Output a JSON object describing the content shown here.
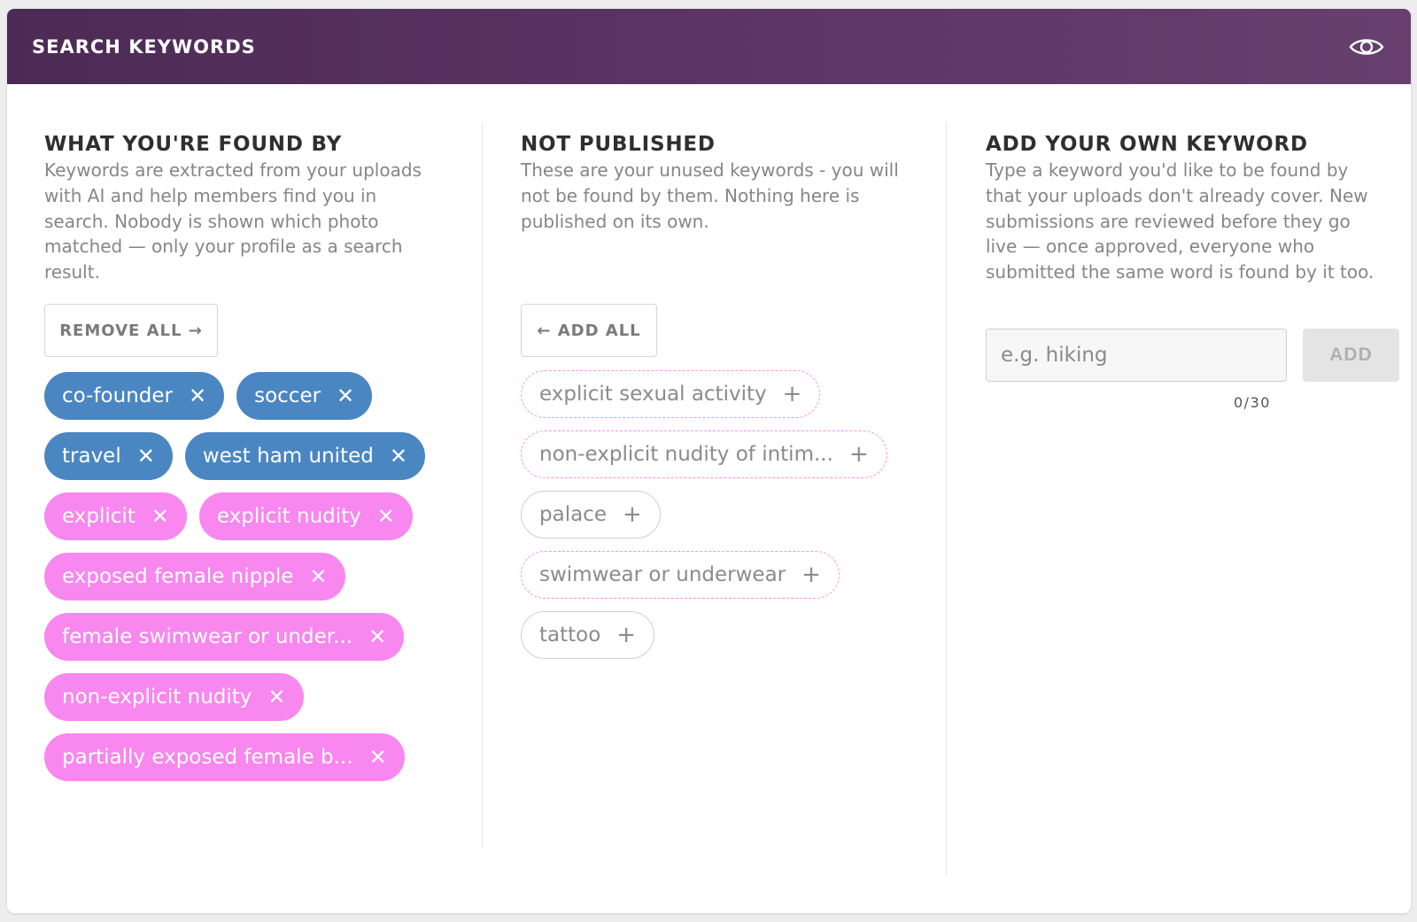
{
  "header": {
    "title": "SEARCH KEYWORDS",
    "icon": "eye-icon"
  },
  "found_by": {
    "title": "WHAT YOU'RE FOUND BY",
    "description": "Keywords are extracted from your uploads with AI and help members find you in search. Nobody is shown which photo matched — only your profile as a search result.",
    "remove_all_label": "REMOVE ALL →",
    "tags": [
      {
        "label": "co-founder",
        "color": "blue"
      },
      {
        "label": "soccer",
        "color": "blue"
      },
      {
        "label": "travel",
        "color": "blue"
      },
      {
        "label": "west ham united",
        "color": "blue"
      },
      {
        "label": "explicit",
        "color": "pink"
      },
      {
        "label": "explicit nudity",
        "color": "pink"
      },
      {
        "label": "exposed female nipple",
        "color": "pink"
      },
      {
        "label": "female swimwear or under...",
        "color": "pink"
      },
      {
        "label": "non-explicit nudity",
        "color": "pink"
      },
      {
        "label": "partially exposed female b...",
        "color": "pink"
      }
    ]
  },
  "not_published": {
    "title": "NOT PUBLISHED",
    "description": "These are your unused keywords - you will not be found by them. Nothing here is published on its own.",
    "add_all_label": "← ADD ALL",
    "tags": [
      {
        "label": "explicit sexual activity",
        "style": "dashed"
      },
      {
        "label": "non-explicit nudity of intim...",
        "style": "dashed"
      },
      {
        "label": "palace",
        "style": "solid"
      },
      {
        "label": "swimwear or underwear",
        "style": "dashed"
      },
      {
        "label": "tattoo",
        "style": "solid"
      }
    ]
  },
  "add_own": {
    "title": "ADD YOUR OWN KEYWORD",
    "description": "Type a keyword you'd like to be found by that your uploads don't already cover. New submissions are reviewed before they go live — once approved, everyone who submitted the same word is found by it too.",
    "input_placeholder": "e.g. hiking",
    "input_value": "",
    "add_label": "ADD",
    "counter": "0/30"
  },
  "colors": {
    "header_start": "#4d2a55",
    "header_end": "#67406e",
    "tag_blue": "#4a86c2",
    "tag_pink": "#f887ef",
    "dashed_border": "#f495ea"
  }
}
